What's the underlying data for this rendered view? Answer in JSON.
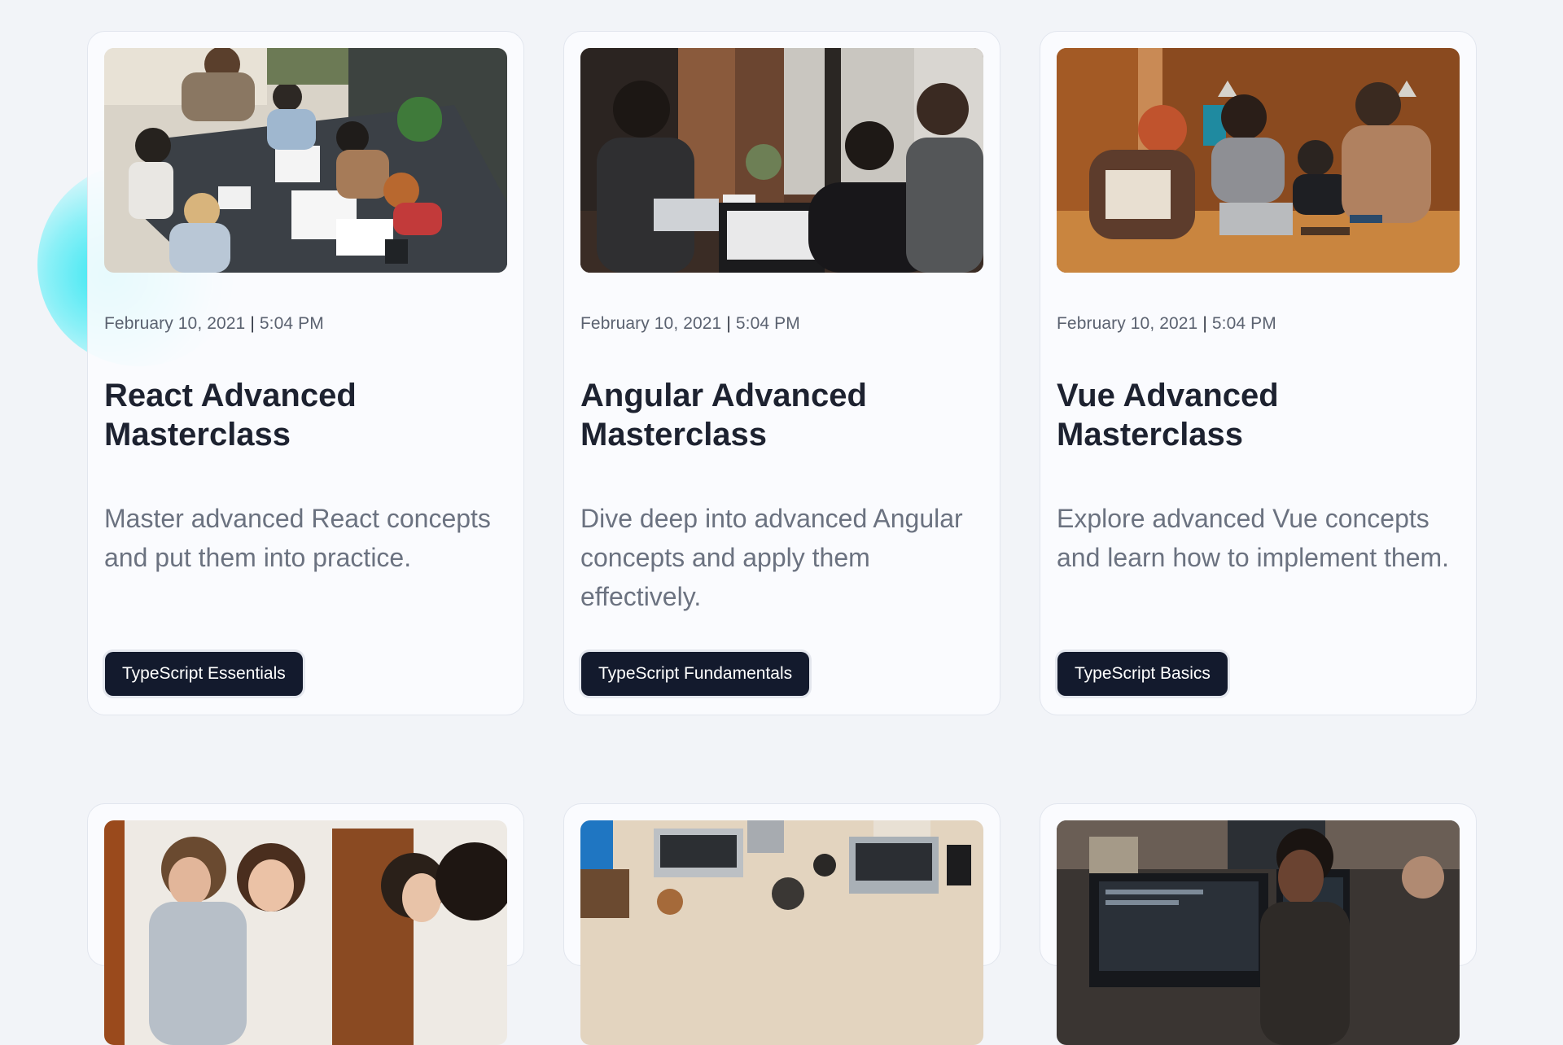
{
  "cards": [
    {
      "date": "February 10, 2021",
      "time": "5:04 PM",
      "title_line1": "React Advanced",
      "title_line2": "Masterclass",
      "description": "Master advanced React concepts and put them into practice.",
      "tag": "TypeScript Essentials",
      "image": "team-meeting-table-photo"
    },
    {
      "date": "February 10, 2021",
      "time": "5:04 PM",
      "title_line1": "Angular Advanced",
      "title_line2": "Masterclass",
      "description": "Dive deep into advanced Angular concepts and apply them effectively.",
      "tag": "TypeScript Fundamentals",
      "image": "coworking-laptops-photo"
    },
    {
      "date": "February 10, 2021",
      "time": "5:04 PM",
      "title_line1": "Vue Advanced",
      "title_line2": "Masterclass",
      "description": "Explore advanced Vue concepts and learn how to implement them.",
      "tag": "TypeScript Basics",
      "image": "team-around-laptop-photo"
    },
    {
      "image": "friends-smiling-photo"
    },
    {
      "image": "desk-laptops-overhead-photo"
    },
    {
      "image": "developer-monitors-photo"
    }
  ],
  "colors": {
    "background": "#f2f4f8",
    "tag_bg": "#131a2d",
    "title": "#1d2230",
    "text_muted": "#6b7280",
    "blob_accent": "#35e6f2"
  }
}
